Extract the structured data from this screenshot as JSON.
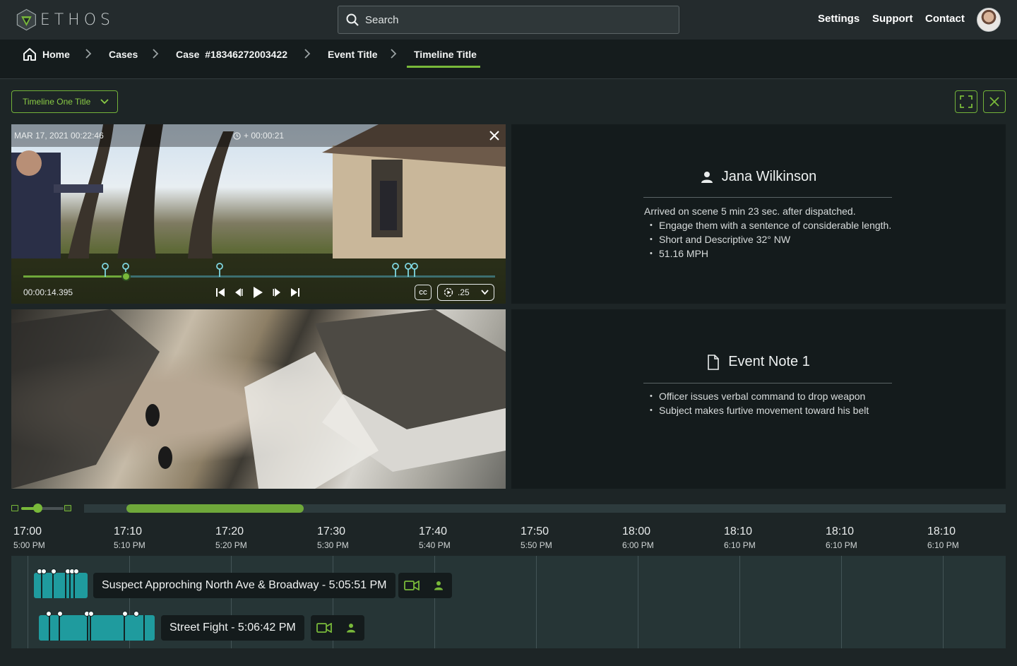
{
  "app": {
    "brand": "ETHOS"
  },
  "search": {
    "placeholder": "Search"
  },
  "topnav": {
    "settings": "Settings",
    "support": "Support",
    "contact": "Contact"
  },
  "breadcrumb": {
    "home": "Home",
    "cases": "Cases",
    "case": "Case  #18346272003422",
    "event": "Event Title",
    "timeline": "Timeline Title"
  },
  "timeline_select": {
    "value": "Timeline One Title"
  },
  "video1": {
    "date": "MAR 17, 2021  00:22:46",
    "offset": "+ 00:00:21",
    "current_time": "00:00:14.395",
    "cc_label": "CC",
    "speed": ".25",
    "progress_fraction": 0.22
  },
  "info_person": {
    "name": "Jana Wilkinson",
    "summary": "Arrived on scene 5 min 23 sec. after dispatched.",
    "bullets": [
      "Engage them with a sentence of considerable length.",
      "Short and Descriptive 32° NW",
      "51.16 MPH"
    ]
  },
  "info_note": {
    "title": "Event Note 1",
    "bullets": [
      "Officer issues verbal command to drop weapon",
      "Subject makes furtive movement toward his belt"
    ]
  },
  "timeline": {
    "ticks": [
      {
        "major": "17:00",
        "minor": "5:00 PM"
      },
      {
        "major": "17:10",
        "minor": "5:10 PM"
      },
      {
        "major": "17:20",
        "minor": "5:20 PM"
      },
      {
        "major": "17:30",
        "minor": "5:30 PM"
      },
      {
        "major": "17:40",
        "minor": "5:40 PM"
      },
      {
        "major": "17:50",
        "minor": "5:50 PM"
      },
      {
        "major": "18:00",
        "minor": "6:00 PM"
      },
      {
        "major": "18:10",
        "minor": "6:10 PM"
      },
      {
        "major": "18:10",
        "minor": "6:10 PM"
      },
      {
        "major": "18:10",
        "minor": "6:10 PM"
      }
    ],
    "events": [
      {
        "label": "Suspect Approching North Ave & Broadway - 5:05:51 PM"
      },
      {
        "label": "Street Fight  - 5:06:42 PM"
      }
    ]
  },
  "colors": {
    "accent": "#79b93a",
    "clip": "#1f9b9e",
    "marker": "#7fd6e0"
  },
  "icons": [
    "search-icon",
    "home-icon",
    "chevron-right-icon",
    "chevron-down-icon",
    "fullscreen-icon",
    "close-icon",
    "clock-icon",
    "skip-start-icon",
    "step-back-icon",
    "play-icon",
    "step-forward-icon",
    "skip-end-icon",
    "cc-icon",
    "speed-icon",
    "person-icon",
    "document-icon",
    "video-camera-icon"
  ]
}
